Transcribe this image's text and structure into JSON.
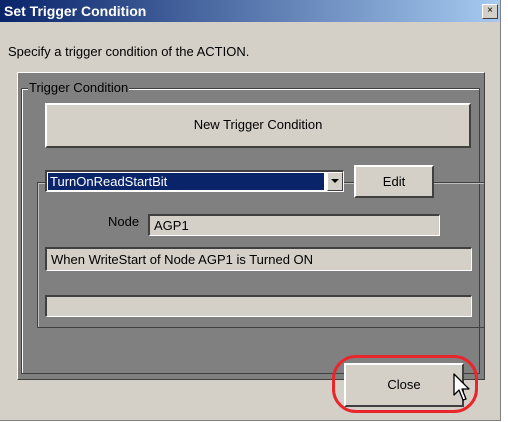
{
  "window": {
    "title": "Set Trigger Condition",
    "close_glyph": "×"
  },
  "description": "Specify a trigger condition of the ACTION.",
  "trigger_group": {
    "label": "Trigger Condition",
    "new_button_label": "New Trigger Condition",
    "dropdown": {
      "selected_value": "TurnOnReadStartBit"
    },
    "edit_button_label": "Edit",
    "node_label": "Node",
    "node_value": "AGP1",
    "condition_text": "When WriteStart of Node AGP1 is Turned ON",
    "extra_text": ""
  },
  "footer": {
    "close_button_label": "Close"
  },
  "colors": {
    "highlight": "#e8262b",
    "titlebar_start": "#0a246a",
    "titlebar_end": "#a6caf0",
    "dialog_bg": "#d4d0c8",
    "group_bg": "#808080"
  }
}
